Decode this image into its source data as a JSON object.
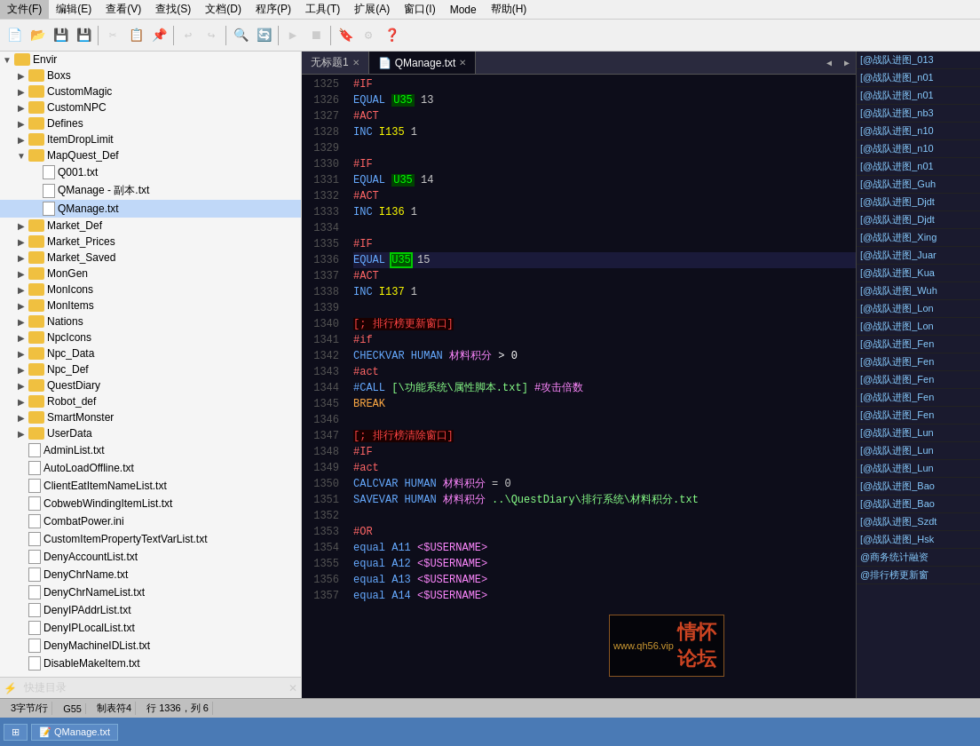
{
  "menubar": {
    "items": [
      "文件(F)",
      "编辑(E)",
      "查看(V)",
      "查找(S)",
      "文档(D)",
      "程序(P)",
      "工具(T)",
      "扩展(A)",
      "窗口(I)",
      "Mode",
      "帮助(H)"
    ]
  },
  "tabs": {
    "items": [
      {
        "label": "无标题1",
        "active": false,
        "closeable": true
      },
      {
        "label": "QManage.txt",
        "active": true,
        "closeable": true
      }
    ]
  },
  "sidebar": {
    "title": "快捷目录",
    "items": [
      {
        "label": "Envir",
        "type": "folder",
        "indent": 0,
        "expanded": true
      },
      {
        "label": "Boxs",
        "type": "folder",
        "indent": 1,
        "expanded": false
      },
      {
        "label": "CustomMagic",
        "type": "folder",
        "indent": 1,
        "expanded": false
      },
      {
        "label": "CustomNPC",
        "type": "folder",
        "indent": 1,
        "expanded": false
      },
      {
        "label": "Defines",
        "type": "folder",
        "indent": 1,
        "expanded": false
      },
      {
        "label": "ItemDropLimit",
        "type": "folder",
        "indent": 1,
        "expanded": false
      },
      {
        "label": "MapQuest_Def",
        "type": "folder",
        "indent": 1,
        "expanded": true
      },
      {
        "label": "Q001.txt",
        "type": "file",
        "indent": 2
      },
      {
        "label": "QManage - 副本.txt",
        "type": "file",
        "indent": 2
      },
      {
        "label": "QManage.txt",
        "type": "file",
        "indent": 2,
        "selected": true
      },
      {
        "label": "Market_Def",
        "type": "folder",
        "indent": 1,
        "expanded": false
      },
      {
        "label": "Market_Prices",
        "type": "folder",
        "indent": 1,
        "expanded": false
      },
      {
        "label": "Market_Saved",
        "type": "folder",
        "indent": 1,
        "expanded": false
      },
      {
        "label": "MonGen",
        "type": "folder",
        "indent": 1,
        "expanded": false
      },
      {
        "label": "MonIcons",
        "type": "folder",
        "indent": 1,
        "expanded": false
      },
      {
        "label": "MonItems",
        "type": "folder",
        "indent": 1,
        "expanded": false
      },
      {
        "label": "Nations",
        "type": "folder",
        "indent": 1,
        "expanded": false
      },
      {
        "label": "NpcIcons",
        "type": "folder",
        "indent": 1,
        "expanded": false
      },
      {
        "label": "Npc_Data",
        "type": "folder",
        "indent": 1,
        "expanded": false
      },
      {
        "label": "Npc_Def",
        "type": "folder",
        "indent": 1,
        "expanded": false
      },
      {
        "label": "QuestDiary",
        "type": "folder",
        "indent": 1,
        "expanded": false
      },
      {
        "label": "Robot_def",
        "type": "folder",
        "indent": 1,
        "expanded": false
      },
      {
        "label": "SmartMonster",
        "type": "folder",
        "indent": 1,
        "expanded": false
      },
      {
        "label": "UserData",
        "type": "folder",
        "indent": 1,
        "expanded": false
      },
      {
        "label": "AdminList.txt",
        "type": "file",
        "indent": 1
      },
      {
        "label": "AutoLoadOffline.txt",
        "type": "file",
        "indent": 1
      },
      {
        "label": "ClientEatItemNameList.txt",
        "type": "file",
        "indent": 1
      },
      {
        "label": "CobwebWindingItemList.txt",
        "type": "file",
        "indent": 1
      },
      {
        "label": "CombatPower.ini",
        "type": "file",
        "indent": 1
      },
      {
        "label": "CustomItemPropertyTextVarList.txt",
        "type": "file",
        "indent": 1
      },
      {
        "label": "DenyAccountList.txt",
        "type": "file",
        "indent": 1
      },
      {
        "label": "DenyChrName.txt",
        "type": "file",
        "indent": 1
      },
      {
        "label": "DenyChrNameList.txt",
        "type": "file",
        "indent": 1
      },
      {
        "label": "DenyIPAddrList.txt",
        "type": "file",
        "indent": 1
      },
      {
        "label": "DenyIPLocalList.txt",
        "type": "file",
        "indent": 1
      },
      {
        "label": "DenyMachineIDList.txt",
        "type": "file",
        "indent": 1
      },
      {
        "label": "DisableMakeItem.txt",
        "type": "file",
        "indent": 1
      }
    ]
  },
  "right_panel": {
    "items": [
      "[@战队进图_013",
      "[@战队进图_n01",
      "[@战队进图_n01",
      "[@战队进图_nb3",
      "[@战队进图_n10",
      "[@战队进图_n10",
      "[@战队进图_n01",
      "[@战队进图_Guh",
      "[@战队进图_Djdt",
      "[@战队进图_Djdt",
      "[@战队进图_Xing",
      "[@战队进图_Juar",
      "[@战队进图_Kua",
      "[@战队进图_Wuh",
      "[@战队进图_Lon",
      "[@战队进图_Lon",
      "[@战队进图_Fen",
      "[@战队进图_Fen",
      "[@战队进图_Fen",
      "[@战队进图_Fen",
      "[@战队进图_Fen",
      "[@战队进图_Lun",
      "[@战队进图_Lun",
      "[@战队进图_Lun",
      "[@战队进图_Bao",
      "[@战队进图_Bao",
      "[@战队进图_Szdt",
      "[@战队进图_Hsk",
      "@商务统计融资",
      "@排行榜更新窗"
    ]
  },
  "code": {
    "lines": [
      {
        "num": 1325,
        "content": "#IF",
        "type": "if"
      },
      {
        "num": 1326,
        "content": "EQUAL U35 13",
        "type": "equal"
      },
      {
        "num": 1327,
        "content": "#ACT",
        "type": "act"
      },
      {
        "num": 1328,
        "content": "INC I135 1",
        "type": "inc"
      },
      {
        "num": 1329,
        "content": "",
        "type": "empty"
      },
      {
        "num": 1330,
        "content": "#IF",
        "type": "if"
      },
      {
        "num": 1331,
        "content": "EQUAL U35 14",
        "type": "equal"
      },
      {
        "num": 1332,
        "content": "#ACT",
        "type": "act"
      },
      {
        "num": 1333,
        "content": "INC I136 1",
        "type": "inc"
      },
      {
        "num": 1334,
        "content": "",
        "type": "empty"
      },
      {
        "num": 1335,
        "content": "#IF",
        "type": "if"
      },
      {
        "num": 1336,
        "content": "EQUAL U35 15",
        "type": "equal",
        "highlighted": true
      },
      {
        "num": 1337,
        "content": "#ACT",
        "type": "act"
      },
      {
        "num": 1338,
        "content": "INC I137 1",
        "type": "inc"
      },
      {
        "num": 1339,
        "content": "",
        "type": "empty"
      },
      {
        "num": 1340,
        "content": "; 排行榜更新窗口",
        "type": "section"
      },
      {
        "num": 1341,
        "content": "#if",
        "type": "if"
      },
      {
        "num": 1342,
        "content": "CHECKVAR HUMAN 材料积分 > 0",
        "type": "checkvar"
      },
      {
        "num": 1343,
        "content": "#act",
        "type": "act"
      },
      {
        "num": 1344,
        "content": "#CALL [\\功能系统\\属性脚本.txt] #攻击倍数",
        "type": "call"
      },
      {
        "num": 1345,
        "content": "BREAK",
        "type": "break"
      },
      {
        "num": 1346,
        "content": "",
        "type": "empty"
      },
      {
        "num": 1347,
        "content": "; 排行榜清除窗口",
        "type": "section"
      },
      {
        "num": 1348,
        "content": "#IF",
        "type": "if"
      },
      {
        "num": 1349,
        "content": "#act",
        "type": "act"
      },
      {
        "num": 1350,
        "content": "CALCVAR HUMAN 材料积分 = 0",
        "type": "calcvar"
      },
      {
        "num": 1351,
        "content": "SAVEVAR HUMAN 材料积分 ..\\QuestDiary\\排行系统\\材料积分.txt",
        "type": "savevar"
      },
      {
        "num": 1352,
        "content": "",
        "type": "empty"
      },
      {
        "num": 1353,
        "content": "#OR",
        "type": "or"
      },
      {
        "num": 1354,
        "content": "equal A11 <$USERNAME>",
        "type": "equal2"
      },
      {
        "num": 1355,
        "content": "equal A12 <$USERNAME>",
        "type": "equal2"
      },
      {
        "num": 1356,
        "content": "equal A13 <$USERNAME>",
        "type": "equal2"
      },
      {
        "num": 1357,
        "content": "equal A14 <$USERNAME>",
        "type": "equal2"
      }
    ]
  },
  "statusbar": {
    "items": [
      "3字节/行",
      "G55",
      "制表符4",
      "行 1336，列 6"
    ]
  },
  "watermark": {
    "line1": "www.qh56.vip",
    "line2": "情怀论坛"
  }
}
